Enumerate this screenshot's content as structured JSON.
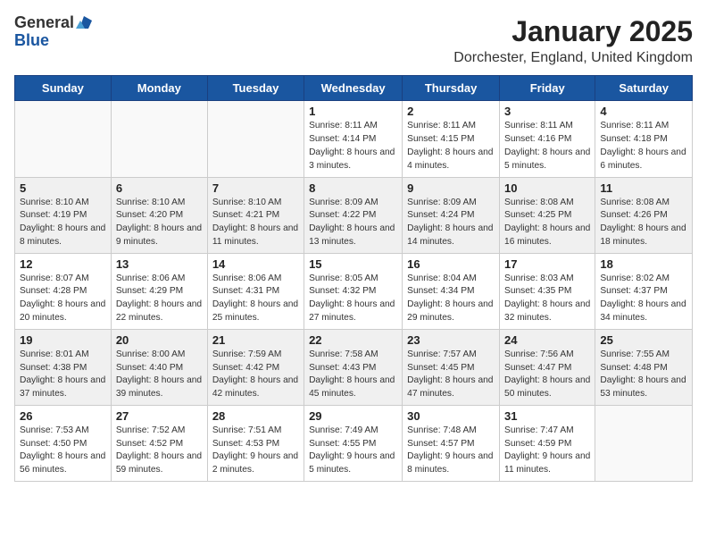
{
  "logo": {
    "general": "General",
    "blue": "Blue"
  },
  "title": {
    "month_year": "January 2025",
    "location": "Dorchester, England, United Kingdom"
  },
  "weekdays": [
    "Sunday",
    "Monday",
    "Tuesday",
    "Wednesday",
    "Thursday",
    "Friday",
    "Saturday"
  ],
  "weeks": [
    {
      "shaded": false,
      "days": [
        {
          "num": "",
          "text": ""
        },
        {
          "num": "",
          "text": ""
        },
        {
          "num": "",
          "text": ""
        },
        {
          "num": "1",
          "text": "Sunrise: 8:11 AM\nSunset: 4:14 PM\nDaylight: 8 hours and 3 minutes."
        },
        {
          "num": "2",
          "text": "Sunrise: 8:11 AM\nSunset: 4:15 PM\nDaylight: 8 hours and 4 minutes."
        },
        {
          "num": "3",
          "text": "Sunrise: 8:11 AM\nSunset: 4:16 PM\nDaylight: 8 hours and 5 minutes."
        },
        {
          "num": "4",
          "text": "Sunrise: 8:11 AM\nSunset: 4:18 PM\nDaylight: 8 hours and 6 minutes."
        }
      ]
    },
    {
      "shaded": true,
      "days": [
        {
          "num": "5",
          "text": "Sunrise: 8:10 AM\nSunset: 4:19 PM\nDaylight: 8 hours and 8 minutes."
        },
        {
          "num": "6",
          "text": "Sunrise: 8:10 AM\nSunset: 4:20 PM\nDaylight: 8 hours and 9 minutes."
        },
        {
          "num": "7",
          "text": "Sunrise: 8:10 AM\nSunset: 4:21 PM\nDaylight: 8 hours and 11 minutes."
        },
        {
          "num": "8",
          "text": "Sunrise: 8:09 AM\nSunset: 4:22 PM\nDaylight: 8 hours and 13 minutes."
        },
        {
          "num": "9",
          "text": "Sunrise: 8:09 AM\nSunset: 4:24 PM\nDaylight: 8 hours and 14 minutes."
        },
        {
          "num": "10",
          "text": "Sunrise: 8:08 AM\nSunset: 4:25 PM\nDaylight: 8 hours and 16 minutes."
        },
        {
          "num": "11",
          "text": "Sunrise: 8:08 AM\nSunset: 4:26 PM\nDaylight: 8 hours and 18 minutes."
        }
      ]
    },
    {
      "shaded": false,
      "days": [
        {
          "num": "12",
          "text": "Sunrise: 8:07 AM\nSunset: 4:28 PM\nDaylight: 8 hours and 20 minutes."
        },
        {
          "num": "13",
          "text": "Sunrise: 8:06 AM\nSunset: 4:29 PM\nDaylight: 8 hours and 22 minutes."
        },
        {
          "num": "14",
          "text": "Sunrise: 8:06 AM\nSunset: 4:31 PM\nDaylight: 8 hours and 25 minutes."
        },
        {
          "num": "15",
          "text": "Sunrise: 8:05 AM\nSunset: 4:32 PM\nDaylight: 8 hours and 27 minutes."
        },
        {
          "num": "16",
          "text": "Sunrise: 8:04 AM\nSunset: 4:34 PM\nDaylight: 8 hours and 29 minutes."
        },
        {
          "num": "17",
          "text": "Sunrise: 8:03 AM\nSunset: 4:35 PM\nDaylight: 8 hours and 32 minutes."
        },
        {
          "num": "18",
          "text": "Sunrise: 8:02 AM\nSunset: 4:37 PM\nDaylight: 8 hours and 34 minutes."
        }
      ]
    },
    {
      "shaded": true,
      "days": [
        {
          "num": "19",
          "text": "Sunrise: 8:01 AM\nSunset: 4:38 PM\nDaylight: 8 hours and 37 minutes."
        },
        {
          "num": "20",
          "text": "Sunrise: 8:00 AM\nSunset: 4:40 PM\nDaylight: 8 hours and 39 minutes."
        },
        {
          "num": "21",
          "text": "Sunrise: 7:59 AM\nSunset: 4:42 PM\nDaylight: 8 hours and 42 minutes."
        },
        {
          "num": "22",
          "text": "Sunrise: 7:58 AM\nSunset: 4:43 PM\nDaylight: 8 hours and 45 minutes."
        },
        {
          "num": "23",
          "text": "Sunrise: 7:57 AM\nSunset: 4:45 PM\nDaylight: 8 hours and 47 minutes."
        },
        {
          "num": "24",
          "text": "Sunrise: 7:56 AM\nSunset: 4:47 PM\nDaylight: 8 hours and 50 minutes."
        },
        {
          "num": "25",
          "text": "Sunrise: 7:55 AM\nSunset: 4:48 PM\nDaylight: 8 hours and 53 minutes."
        }
      ]
    },
    {
      "shaded": false,
      "days": [
        {
          "num": "26",
          "text": "Sunrise: 7:53 AM\nSunset: 4:50 PM\nDaylight: 8 hours and 56 minutes."
        },
        {
          "num": "27",
          "text": "Sunrise: 7:52 AM\nSunset: 4:52 PM\nDaylight: 8 hours and 59 minutes."
        },
        {
          "num": "28",
          "text": "Sunrise: 7:51 AM\nSunset: 4:53 PM\nDaylight: 9 hours and 2 minutes."
        },
        {
          "num": "29",
          "text": "Sunrise: 7:49 AM\nSunset: 4:55 PM\nDaylight: 9 hours and 5 minutes."
        },
        {
          "num": "30",
          "text": "Sunrise: 7:48 AM\nSunset: 4:57 PM\nDaylight: 9 hours and 8 minutes."
        },
        {
          "num": "31",
          "text": "Sunrise: 7:47 AM\nSunset: 4:59 PM\nDaylight: 9 hours and 11 minutes."
        },
        {
          "num": "",
          "text": ""
        }
      ]
    }
  ]
}
